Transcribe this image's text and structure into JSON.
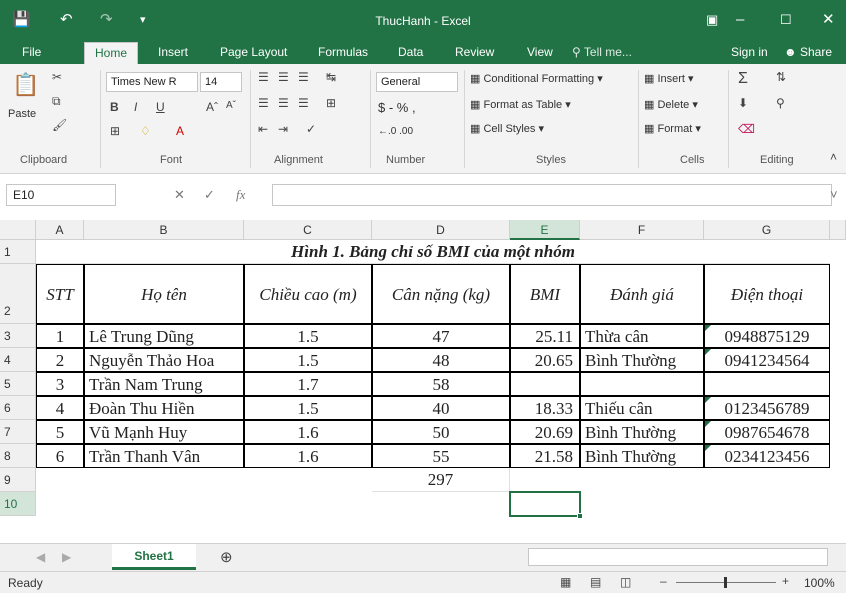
{
  "window": {
    "title": "ThucHanh - Excel"
  },
  "tabs": [
    "File",
    "Home",
    "Insert",
    "Page Layout",
    "Formulas",
    "Data",
    "Review",
    "View",
    "Tell me...",
    "Sign in",
    "Share"
  ],
  "ribbon": {
    "clipboard": {
      "label": "Clipboard",
      "paste": "Paste"
    },
    "font": {
      "label": "Font",
      "name": "Times New R",
      "size": "14"
    },
    "alignment": {
      "label": "Alignment"
    },
    "number": {
      "label": "Number",
      "format": "General",
      "symbols": "$ - % ,",
      "decimals": "←.0 .00"
    },
    "styles": {
      "label": "Styles",
      "conditional": "Conditional Formatting",
      "format_table": "Format as Table",
      "cell_styles": "Cell Styles"
    },
    "cells": {
      "label": "Cells",
      "insert": "Insert",
      "delete": "Delete",
      "format": "Format"
    },
    "editing": {
      "label": "Editing"
    }
  },
  "formula_bar": {
    "namebox": "E10",
    "fx": "fx",
    "value": ""
  },
  "grid": {
    "columns": [
      "A",
      "B",
      "C",
      "D",
      "E",
      "F",
      "G"
    ],
    "rows": [
      "1",
      "2",
      "3",
      "4",
      "5",
      "6",
      "7",
      "8",
      "9",
      "10"
    ],
    "title": "Hình 1. Bảng chỉ số BMI của một nhóm",
    "headers": [
      "STT",
      "Họ tên",
      "Chiều cao (m)",
      "Cân nặng (kg)",
      "BMI",
      "Đánh giá",
      "Điện thoại"
    ],
    "data": [
      [
        "1",
        "Lê Trung Dũng",
        "1.5",
        "47",
        "25.11",
        "Thừa cân",
        "0948875129"
      ],
      [
        "2",
        "Nguyễn Thảo Hoa",
        "1.5",
        "48",
        "20.65",
        "Bình Thường",
        "0941234564"
      ],
      [
        "3",
        "Trần Nam Trung",
        "1.7",
        "58",
        "",
        "",
        ""
      ],
      [
        "4",
        "Đoàn Thu Hiền",
        "1.5",
        "40",
        "18.33",
        "Thiếu cân",
        "0123456789"
      ],
      [
        "5",
        "Vũ Mạnh Huy",
        "1.6",
        "50",
        "20.69",
        "Bình Thường",
        "0987654678"
      ],
      [
        "6",
        "Trần Thanh Vân",
        "1.6",
        "55",
        "21.58",
        "Bình Thường",
        "0234123456"
      ]
    ],
    "sum_label": "297",
    "selected_cell": "E10"
  },
  "sheets": [
    "Sheet1"
  ],
  "status": {
    "state": "Ready",
    "zoom": "100%"
  }
}
